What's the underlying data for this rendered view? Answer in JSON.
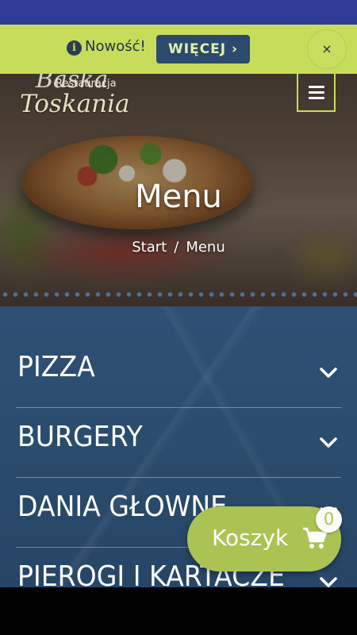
{
  "notice": {
    "text": "Nowość!",
    "button_label": "WIĘCEJ ›",
    "close_label": "×"
  },
  "header": {
    "logo_script": "Baśka",
    "logo_subtitle": "Restauracja",
    "logo_name": "Toskania",
    "menu_icon": "hamburger-icon"
  },
  "hero": {
    "title": "Menu",
    "breadcrumb": {
      "start": "Start",
      "separator": "/",
      "current": "Menu"
    }
  },
  "categories": [
    {
      "label": "PIZZA"
    },
    {
      "label": "BURGERY"
    },
    {
      "label": "DANIA GŁOWNE"
    },
    {
      "label": "PIEROGI I KARTACZE"
    }
  ],
  "cart": {
    "label": "Koszyk",
    "count": "0",
    "icon": "shopping-cart-icon"
  },
  "colors": {
    "statusbar": "#2f3b95",
    "accent_green": "#c7dc5b",
    "cart_green": "#aac353",
    "button_blue": "#2b4a6e",
    "menu_bg": "#2d5074"
  }
}
